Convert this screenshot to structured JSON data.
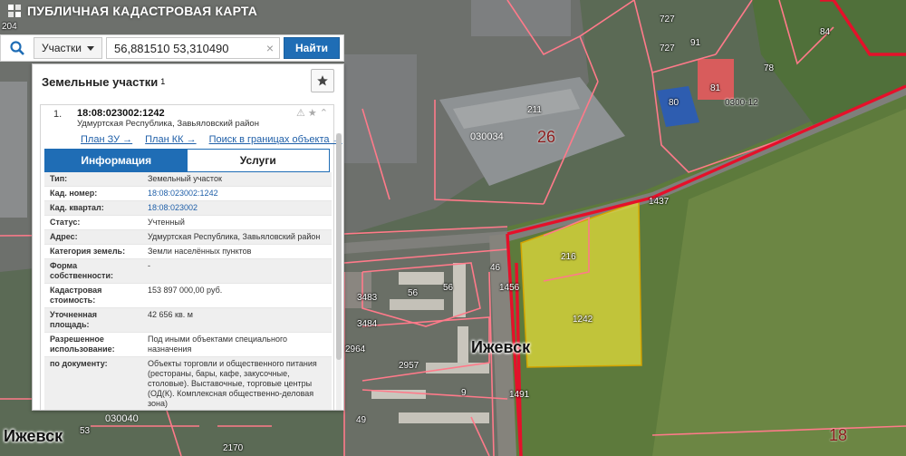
{
  "app": {
    "title": "ПУБЛИЧНАЯ КАДАСТРОВАЯ КАРТА"
  },
  "search": {
    "type_label": "Участки",
    "query": "56,881510 53,310490",
    "clear_symbol": "×",
    "submit_label": "Найти"
  },
  "panel": {
    "title": "Земельные участки",
    "count": "1",
    "result": {
      "index": "1.",
      "cad_number": "18:08:023002:1242",
      "address": "Удмуртская Республика, Завьяловский район",
      "links": [
        "План ЗУ →",
        "План КК →",
        "Поиск в границах объекта →"
      ]
    },
    "tabs": [
      "Информация",
      "Услуги"
    ],
    "active_tab": 0,
    "fields": [
      {
        "key": "Тип:",
        "value": "Земельный участок"
      },
      {
        "key": "Кад. номер:",
        "value": "18:08:023002:1242",
        "link": true
      },
      {
        "key": "Кад. квартал:",
        "value": "18:08:023002",
        "link": true
      },
      {
        "key": "Статус:",
        "value": "Учтенный"
      },
      {
        "key": "Адрес:",
        "value": "Удмуртская Республика, Завьяловский район"
      },
      {
        "key": "Категория земель:",
        "value": "Земли населённых пунктов"
      },
      {
        "key": "Форма собственности:",
        "value": "-"
      },
      {
        "key": "Кадастровая стоимость:",
        "value": "153 897 000,00 руб."
      },
      {
        "key": "Уточненная площадь:",
        "value": "42 656 кв. м"
      },
      {
        "key": "Разрешенное использование:",
        "value": "Под иными объектами специального назначения"
      },
      {
        "key": "по документу:",
        "value": "Объекты торговли и общественного питания (рестораны, бары, кафе, закусочные, столовые). Выставочные, торговые центры (ОД(К). Комплексная общественно-деловая зона)"
      }
    ]
  },
  "map": {
    "labels": [
      {
        "text": "204",
        "cls": "lbl-small"
      },
      {
        "text": "727",
        "cls": "lbl-small"
      },
      {
        "text": "727",
        "cls": "lbl-small"
      },
      {
        "text": "91",
        "cls": "lbl-small"
      },
      {
        "text": "84",
        "cls": "lbl-small"
      },
      {
        "text": "78",
        "cls": "lbl-small"
      },
      {
        "text": "81",
        "cls": "lbl-small"
      },
      {
        "text": "80",
        "cls": "lbl-small"
      },
      {
        "text": "0300-12",
        "cls": "lbl-dark"
      },
      {
        "text": "211",
        "cls": "lbl-small"
      },
      {
        "text": "030034",
        "cls": "lbl-quarter"
      },
      {
        "text": "26",
        "cls": "lbl-big"
      },
      {
        "text": "1437",
        "cls": "lbl-small"
      },
      {
        "text": "216",
        "cls": "lbl-small"
      },
      {
        "text": "1242",
        "cls": "lbl-small"
      },
      {
        "text": "46",
        "cls": "lbl-small"
      },
      {
        "text": "1456",
        "cls": "lbl-small"
      },
      {
        "text": "3483",
        "cls": "lbl-small"
      },
      {
        "text": "56",
        "cls": "lbl-small"
      },
      {
        "text": "56",
        "cls": "lbl-small"
      },
      {
        "text": "3484",
        "cls": "lbl-small"
      },
      {
        "text": "2964",
        "cls": "lbl-small"
      },
      {
        "text": "2957",
        "cls": "lbl-small"
      },
      {
        "text": "9",
        "cls": "lbl-small"
      },
      {
        "text": "1491",
        "cls": "lbl-small"
      },
      {
        "text": "49",
        "cls": "lbl-small"
      },
      {
        "text": "53",
        "cls": "lbl-small"
      },
      {
        "text": "030040",
        "cls": "lbl-quarter"
      },
      {
        "text": "2170",
        "cls": "lbl-small"
      },
      {
        "text": "18",
        "cls": "lbl-big"
      },
      {
        "text": "Ижевск",
        "cls": "lbl-city"
      },
      {
        "text": "Ижевск",
        "cls": "lbl-city"
      }
    ]
  }
}
